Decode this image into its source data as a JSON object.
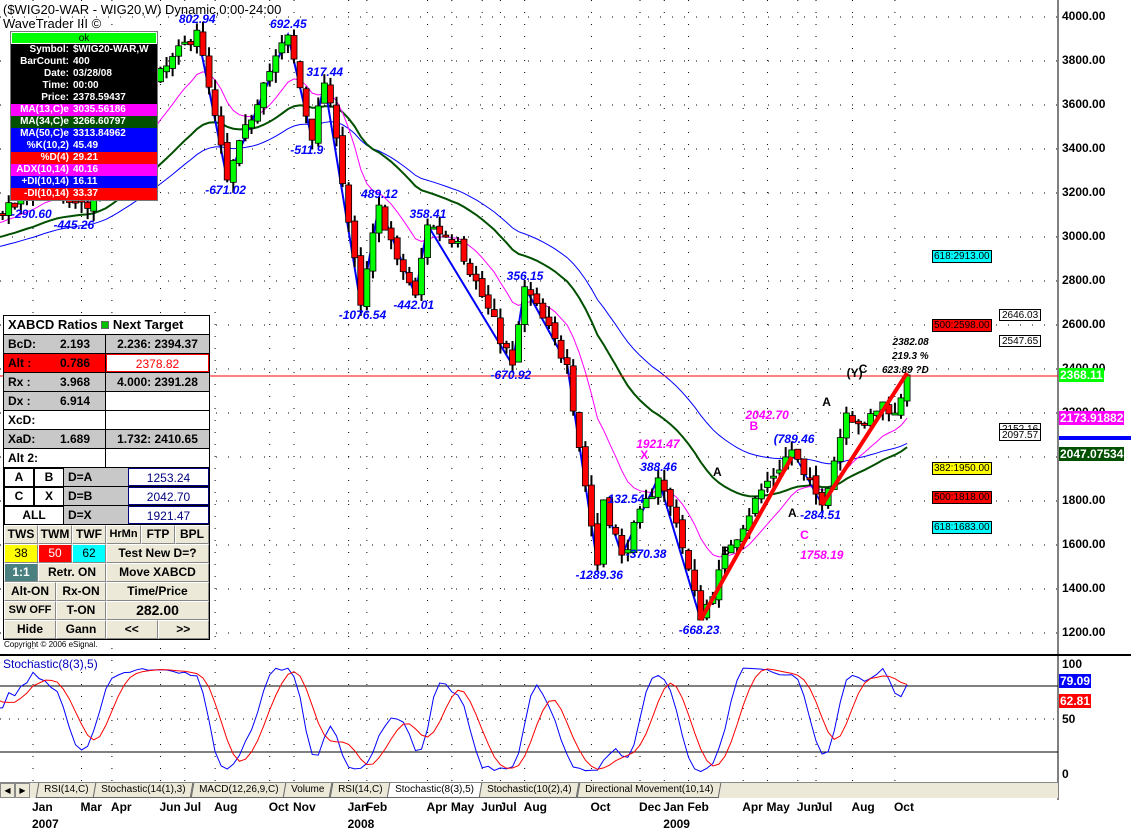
{
  "header": {
    "title": "($WIG20-WAR - WIG20,W) Dynamic,0:00-24:00",
    "subtitle": "WaveTrader III ©"
  },
  "info_panel": {
    "status": "ok",
    "rows": [
      {
        "k": "Symbol:",
        "v": "$WIG20-WAR,W",
        "bg": "#000000"
      },
      {
        "k": "BarCount:",
        "v": "400",
        "bg": "#000000"
      },
      {
        "k": "Date:",
        "v": "03/28/08",
        "bg": "#000000"
      },
      {
        "k": "Time:",
        "v": "00:00",
        "bg": "#000000"
      },
      {
        "k": "Price:",
        "v": "2378.59437",
        "bg": "#000000"
      },
      {
        "k": "MA(13,C)e",
        "v": "3035.56186",
        "bg": "#ff00ff"
      },
      {
        "k": "MA(34,C)e",
        "v": "3266.60797",
        "bg": "#005000"
      },
      {
        "k": "MA(50,C)e",
        "v": "3313.84962",
        "bg": "#0000ff"
      },
      {
        "k": "%K(10,2)",
        "v": "45.49",
        "bg": "#0000ff"
      },
      {
        "k": "%D(4)",
        "v": "29.21",
        "bg": "#ff0000"
      },
      {
        "k": "ADX(10,14)",
        "v": "40.16",
        "bg": "#ff00ff"
      },
      {
        "k": "+DI(10,14)",
        "v": "16.11",
        "bg": "#0000ff"
      },
      {
        "k": "-DI(10,14)",
        "v": "33.37",
        "bg": "#ff0000"
      }
    ]
  },
  "xabcd": {
    "header": "XABCD Ratios",
    "header2": "Next Target",
    "rows": [
      {
        "a": "BcD:",
        "b": "2.193",
        "t": "2.236: 2394.37"
      },
      {
        "a": "Alt  :",
        "b": "0.786",
        "t": "2378.82"
      },
      {
        "a": "Rx   :",
        "b": "3.968",
        "t": "4.000: 2391.28"
      },
      {
        "a": "Dx   :",
        "b": "6.914",
        "t": ""
      },
      {
        "a": "XcD:",
        "b": "",
        "t": ""
      },
      {
        "a": "XaD:",
        "b": "1.689",
        "t": "1.732: 2410.65"
      },
      {
        "a": "Alt 2:",
        "b": "",
        "t": ""
      }
    ],
    "targets": [
      {
        "l1": "A",
        "l2": "B",
        "d": "D=A",
        "v": "1253.24"
      },
      {
        "l1": "C",
        "l2": "X",
        "d": "D=B",
        "v": "2042.70"
      },
      {
        "l1": "ALL",
        "l2": "",
        "d": "D=X",
        "v": "1921.47"
      }
    ],
    "buttons": {
      "tws": "TWS",
      "twm": "TWM",
      "twf": "TWF",
      "hrmn": "HrMn",
      "ftp": "FTP",
      "bpl": "BPL",
      "b38": "38",
      "b50": "50",
      "b62": "62",
      "test": "Test New D=?",
      "ratio": "1:1",
      "retr": "Retr. ON",
      "move": "Move XABCD",
      "alt": "Alt-ON",
      "rx": "Rx-ON",
      "tp": "Time/Price",
      "sw": "SW OFF",
      "ton": "T-ON",
      "value": "282.00",
      "hide": "Hide",
      "gann": "Gann",
      "prev": "<<",
      "next": ">>"
    },
    "copyright": "Copyright © 2006 eSignal."
  },
  "fib_levels": [
    {
      "label": "618:2913.00",
      "price": 2913,
      "color": "#00ffff"
    },
    {
      "label": "500:2598.00",
      "price": 2598,
      "color": "#ff0000"
    },
    {
      "label": "382:1950.00",
      "price": 1950,
      "color": "#ffff00"
    },
    {
      "label": "500:1818.00",
      "price": 1818,
      "color": "#ff0000"
    },
    {
      "label": "618:1683.00",
      "price": 1683,
      "color": "#00ffff"
    }
  ],
  "target_boxes": [
    {
      "v": "2646.03",
      "price": 2646
    },
    {
      "v": "2547.65",
      "price": 2547
    },
    {
      "v": "2152.16",
      "price": 2152
    },
    {
      "v": "2097.57",
      "price": 2097
    }
  ],
  "projection": {
    "l1": "2382.08",
    "l2": "219.3 %",
    "l3": "623.89 ?D"
  },
  "price_tags": [
    {
      "v": "2368.11",
      "price": 2368,
      "bg": "#00ff00"
    },
    {
      "v": "2173.91882",
      "price": 2174,
      "bg": "#ff00ff"
    },
    {
      "v": "2047.07534",
      "price": 2047,
      "bg": "#005000"
    }
  ],
  "stoch": {
    "label": "Stochastic(8(3),5)",
    "k": "79.09",
    "d": "62.81",
    "ticks": [
      "100",
      "50",
      "0"
    ]
  },
  "tabs": [
    "RSI(14,C)",
    "Stochastic(14(1),3)",
    "MACD(12,26,9,C)",
    "Volume",
    "RSI(14,C)",
    "Stochastic(8(3),5)",
    "Stochastic(10(2),4)",
    "Directional Movement(10,14)"
  ],
  "active_tab": 5,
  "chart_data": {
    "type": "candlestick",
    "title": "($WIG20-WAR - WIG20,W) Dynamic,0:00-24:00",
    "x_unit": "weeks since Jan 2007",
    "ylim": [
      1200,
      4000
    ],
    "y_ticks": [
      "4000.00",
      "3800.00",
      "3600.00",
      "3400.00",
      "3200.00",
      "3000.00",
      "2800.00",
      "2600.00",
      "2400.00",
      "2200.00",
      "2000.00",
      "1800.00",
      "1600.00",
      "1400.00",
      "1200.00"
    ],
    "x_ticks": [
      {
        "w": 0,
        "l": "Jan"
      },
      {
        "w": 8,
        "l": "Mar"
      },
      {
        "w": 13,
        "l": "Apr"
      },
      {
        "w": 21,
        "l": "Jun"
      },
      {
        "w": 25,
        "l": "Jul"
      },
      {
        "w": 30,
        "l": "Aug"
      },
      {
        "w": 39,
        "l": "Oct"
      },
      {
        "w": 43,
        "l": "Nov"
      },
      {
        "w": 52,
        "l": "Jan"
      },
      {
        "w": 55,
        "l": "Feb"
      },
      {
        "w": 65,
        "l": "Apr"
      },
      {
        "w": 69,
        "l": "May"
      },
      {
        "w": 74,
        "l": "Jun"
      },
      {
        "w": 77,
        "l": "Jul"
      },
      {
        "w": 81,
        "l": "Aug"
      },
      {
        "w": 92,
        "l": "Oct"
      },
      {
        "w": 100,
        "l": "Dec"
      },
      {
        "w": 104,
        "l": "Jan"
      },
      {
        "w": 108,
        "l": "Feb"
      },
      {
        "w": 117,
        "l": "Apr"
      },
      {
        "w": 121,
        "l": "May"
      },
      {
        "w": 126,
        "l": "Jun"
      },
      {
        "w": 129,
        "l": "Jul"
      },
      {
        "w": 135,
        "l": "Aug"
      },
      {
        "w": 142,
        "l": "Oct"
      }
    ],
    "years": [
      {
        "w": 0,
        "l": "2007"
      },
      {
        "w": 52,
        "l": "2008"
      },
      {
        "w": 104,
        "l": "2009"
      }
    ],
    "price_path": [
      [
        -60,
        2700
      ],
      [
        -30,
        2950
      ],
      [
        -5,
        3100
      ],
      [
        2,
        3250
      ],
      [
        5,
        3180
      ],
      [
        9,
        3130
      ],
      [
        14,
        3500
      ],
      [
        20,
        3700
      ],
      [
        27,
        3940
      ],
      [
        32,
        3259
      ],
      [
        38,
        3700
      ],
      [
        42,
        3918
      ],
      [
        46,
        3440
      ],
      [
        48,
        3700
      ],
      [
        50,
        3450
      ],
      [
        54,
        2690
      ],
      [
        57,
        3145
      ],
      [
        60,
        2900
      ],
      [
        63,
        2736
      ],
      [
        65,
        3055
      ],
      [
        70,
        2980
      ],
      [
        79,
        2418
      ],
      [
        81,
        2774
      ],
      [
        88,
        2420
      ],
      [
        93,
        1509
      ],
      [
        94,
        1805
      ],
      [
        97,
        1554
      ],
      [
        103,
        1905
      ],
      [
        106,
        1700
      ],
      [
        110,
        1259
      ],
      [
        115,
        1600
      ],
      [
        120,
        1850
      ],
      [
        125,
        2032
      ],
      [
        127,
        1920
      ],
      [
        130,
        1782
      ],
      [
        134,
        2200
      ],
      [
        137,
        2150
      ],
      [
        140,
        2250
      ],
      [
        142,
        2200
      ],
      [
        144,
        2373
      ]
    ],
    "swing_labels": [
      {
        "w": 0,
        "p": 3150,
        "t": "-290.60",
        "c": "#0000ff",
        "pos": "below"
      },
      {
        "w": 7,
        "p": 3100,
        "t": "-445.26",
        "c": "#0000ff",
        "pos": "below"
      },
      {
        "w": 27,
        "p": 3940,
        "t": "802.94",
        "c": "#0000ff",
        "pos": "above"
      },
      {
        "w": 32,
        "p": 3259,
        "t": "-671.02",
        "c": "#0000ff",
        "pos": "below"
      },
      {
        "w": 42,
        "p": 3918,
        "t": "692.45",
        "c": "#0000ff",
        "pos": "above"
      },
      {
        "w": 48,
        "p": 3700,
        "t": "317.44",
        "c": "#0000ff",
        "pos": "above"
      },
      {
        "w": 46,
        "p": 3440,
        "t": "-511.9",
        "c": "#0000ff",
        "pos": "below"
      },
      {
        "w": 57,
        "p": 3145,
        "t": "489.12",
        "c": "#0000ff",
        "pos": "above"
      },
      {
        "w": 54,
        "p": 2690,
        "t": "-1076.54",
        "c": "#0000ff",
        "pos": "below"
      },
      {
        "w": 65,
        "p": 3055,
        "t": "358.41",
        "c": "#0000ff",
        "pos": "above"
      },
      {
        "w": 63,
        "p": 2736,
        "t": "-442.01",
        "c": "#0000ff",
        "pos": "below"
      },
      {
        "w": 81,
        "p": 2774,
        "t": "356.15",
        "c": "#0000ff",
        "pos": "above"
      },
      {
        "w": 79,
        "p": 2418,
        "t": "-670.92",
        "c": "#0000ff",
        "pos": "below"
      },
      {
        "w": 94,
        "p": 1805,
        "t": "132.54",
        "c": "#0000ff",
        "pos": "right"
      },
      {
        "w": 93,
        "p": 1509,
        "t": "-1289.36",
        "c": "#0000ff",
        "pos": "below"
      },
      {
        "w": 97,
        "p": 1554,
        "t": "-370.38",
        "c": "#0000ff",
        "pos": "right"
      },
      {
        "w": 103,
        "p": 1905,
        "t": "388.46",
        "c": "#0000ff",
        "pos": "above"
      },
      {
        "w": 110,
        "p": 1259,
        "t": "-668.23",
        "c": "#0000ff",
        "pos": "below"
      },
      {
        "w": 125,
        "p": 2032,
        "t": "(789.46",
        "c": "#0000ff",
        "pos": "above"
      },
      {
        "w": 130,
        "p": 1782,
        "t": "-284.51",
        "c": "#0000ff",
        "pos": "below"
      },
      {
        "w": 103,
        "p": 2010,
        "t": "1921.47",
        "c": "#ff00ff",
        "pos": "above2"
      },
      {
        "w": 103,
        "p": 1960,
        "t": "X",
        "c": "#ff00ff",
        "pos": "above"
      },
      {
        "w": 121,
        "p": 2140,
        "t": "2042.70",
        "c": "#ff00ff",
        "pos": "above2"
      },
      {
        "w": 121,
        "p": 2090,
        "t": "B",
        "c": "#ff00ff",
        "pos": "above"
      },
      {
        "w": 130,
        "p": 1690,
        "t": "C",
        "c": "#ff00ff",
        "pos": "below"
      },
      {
        "w": 130,
        "p": 1600,
        "t": "1758.19",
        "c": "#ff00ff",
        "pos": "below"
      },
      {
        "w": 115,
        "p": 1880,
        "t": "A",
        "c": "#000000",
        "pos": "above"
      },
      {
        "w": 117,
        "p": 1620,
        "t": "B",
        "c": "#000000",
        "pos": "below"
      },
      {
        "w": 128,
        "p": 1790,
        "t": "A",
        "c": "#000000",
        "pos": "below"
      },
      {
        "w": 133,
        "p": 2200,
        "t": "A",
        "c": "#000000",
        "pos": "above"
      },
      {
        "w": 137,
        "p": 2330,
        "t": "(Y)",
        "c": "#000000",
        "pos": "above"
      },
      {
        "w": 139,
        "p": 2350,
        "t": "C",
        "c": "#000000",
        "pos": "above"
      }
    ]
  }
}
